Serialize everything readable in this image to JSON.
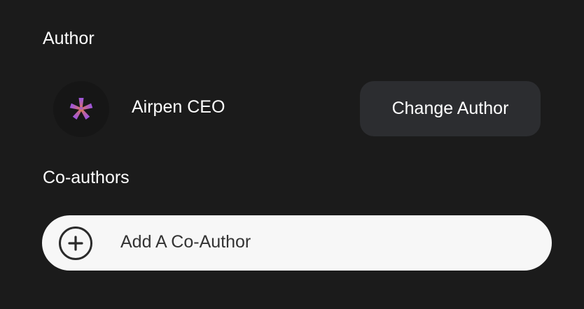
{
  "author": {
    "section_label": "Author",
    "name": "Airpen CEO",
    "avatar_icon": "asterisk-logo-icon",
    "change_button_label": "Change Author"
  },
  "coauthors": {
    "section_label": "Co-authors",
    "add_label": "Add A Co-Author",
    "add_icon": "plus-circle-icon"
  },
  "colors": {
    "background": "#1b1b1b",
    "button": "#2c2d30",
    "input": "#f7f7f7",
    "logo_top": "#9b55e0",
    "logo_bottom": "#e0843a"
  }
}
